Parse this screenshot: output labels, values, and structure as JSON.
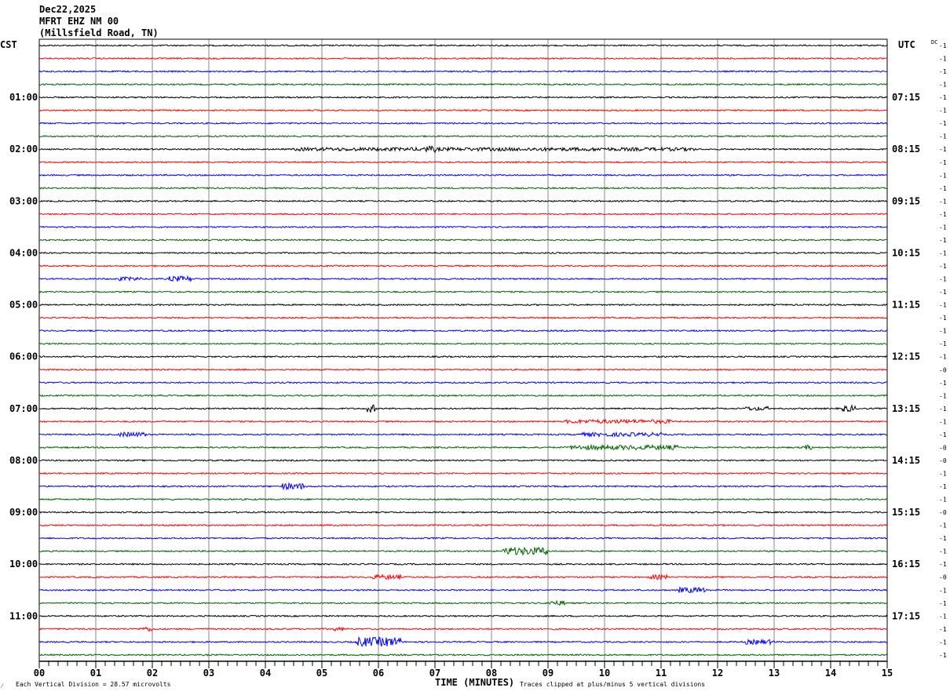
{
  "header": {
    "date": "Dec22,2025",
    "station": "MFRT EHZ NM 00",
    "location": "(Millsfield Road, TN)"
  },
  "chart_data": {
    "type": "line",
    "subtype": "helicorder",
    "xlabel": "TIME (MINUTES)",
    "xlim": [
      0,
      15
    ],
    "x_ticks": [
      "00",
      "01",
      "02",
      "03",
      "04",
      "05",
      "06",
      "07",
      "08",
      "09",
      "10",
      "11",
      "12",
      "13",
      "14",
      "15"
    ],
    "left_timezone": "CST",
    "right_timezone": "UTC",
    "left_hour_labels": [
      "01:00",
      "02:00",
      "03:00",
      "04:00",
      "05:00",
      "06:00",
      "07:00",
      "08:00",
      "09:00",
      "10:00",
      "11:00"
    ],
    "right_hour_labels": [
      "07:15",
      "08:15",
      "09:15",
      "10:15",
      "11:15",
      "12:15",
      "13:15",
      "14:15",
      "15:15",
      "16:15",
      "17:15"
    ],
    "dc_header": "DC",
    "dc_offsets": [
      "-1",
      "-1",
      "-1",
      "-1",
      "-1",
      "-1",
      "-1",
      "-1",
      "-1",
      "-1",
      "-1",
      "-1",
      "-1",
      "-1",
      "-1",
      "-1",
      "-1",
      "-1",
      "-1",
      "-1",
      "-1",
      "-1",
      "-1",
      "-1",
      "-1",
      "-0",
      "-1",
      "-1",
      "-1",
      "-1",
      "-1",
      "-0",
      "-0",
      "-1",
      "-1",
      "-1",
      "-0",
      "-1",
      "-1",
      "-1",
      "-1",
      "-0",
      "-1",
      "-1",
      "-1",
      "-1",
      "-1",
      "-1"
    ],
    "trace_colors": [
      "#000000",
      "#ff0000",
      "#0000ff",
      "#006400"
    ],
    "grid": true,
    "events": [
      {
        "trace": 8,
        "start_min": 4.5,
        "end_min": 11.6,
        "amplitude": 2.2
      },
      {
        "trace": 8,
        "start_min": 6.8,
        "end_min": 7.0,
        "amplitude": 4
      },
      {
        "trace": 18,
        "start_min": 1.4,
        "end_min": 1.8,
        "amplitude": 2.5
      },
      {
        "trace": 18,
        "start_min": 2.3,
        "end_min": 2.7,
        "amplitude": 3.5
      },
      {
        "trace": 28,
        "start_min": 5.8,
        "end_min": 5.95,
        "amplitude": 5
      },
      {
        "trace": 28,
        "start_min": 12.5,
        "end_min": 12.9,
        "amplitude": 2.5
      },
      {
        "trace": 28,
        "start_min": 14.2,
        "end_min": 14.45,
        "amplitude": 4
      },
      {
        "trace": 29,
        "start_min": 9.3,
        "end_min": 11.2,
        "amplitude": 2.5
      },
      {
        "trace": 30,
        "start_min": 1.4,
        "end_min": 1.9,
        "amplitude": 3
      },
      {
        "trace": 30,
        "start_min": 9.5,
        "end_min": 11.0,
        "amplitude": 2.5
      },
      {
        "trace": 31,
        "start_min": 9.4,
        "end_min": 11.3,
        "amplitude": 3
      },
      {
        "trace": 31,
        "start_min": 13.5,
        "end_min": 13.7,
        "amplitude": 3
      },
      {
        "trace": 34,
        "start_min": 4.3,
        "end_min": 4.7,
        "amplitude": 4
      },
      {
        "trace": 39,
        "start_min": 8.2,
        "end_min": 9.0,
        "amplitude": 5
      },
      {
        "trace": 41,
        "start_min": 5.9,
        "end_min": 6.4,
        "amplitude": 3
      },
      {
        "trace": 41,
        "start_min": 10.8,
        "end_min": 11.1,
        "amplitude": 3
      },
      {
        "trace": 42,
        "start_min": 11.3,
        "end_min": 11.8,
        "amplitude": 3.5
      },
      {
        "trace": 43,
        "start_min": 9.0,
        "end_min": 9.3,
        "amplitude": 3
      },
      {
        "trace": 45,
        "start_min": 1.8,
        "end_min": 2.0,
        "amplitude": 3
      },
      {
        "trace": 45,
        "start_min": 5.2,
        "end_min": 5.4,
        "amplitude": 2.5
      },
      {
        "trace": 46,
        "start_min": 5.6,
        "end_min": 6.4,
        "amplitude": 6
      },
      {
        "trace": 46,
        "start_min": 12.5,
        "end_min": 13.0,
        "amplitude": 3
      }
    ]
  },
  "footer": {
    "scale_note": "Each Vertical Division =   28.57 microvolts",
    "clip_note": "Traces clipped at plus/minus 5 vertical divisions"
  }
}
